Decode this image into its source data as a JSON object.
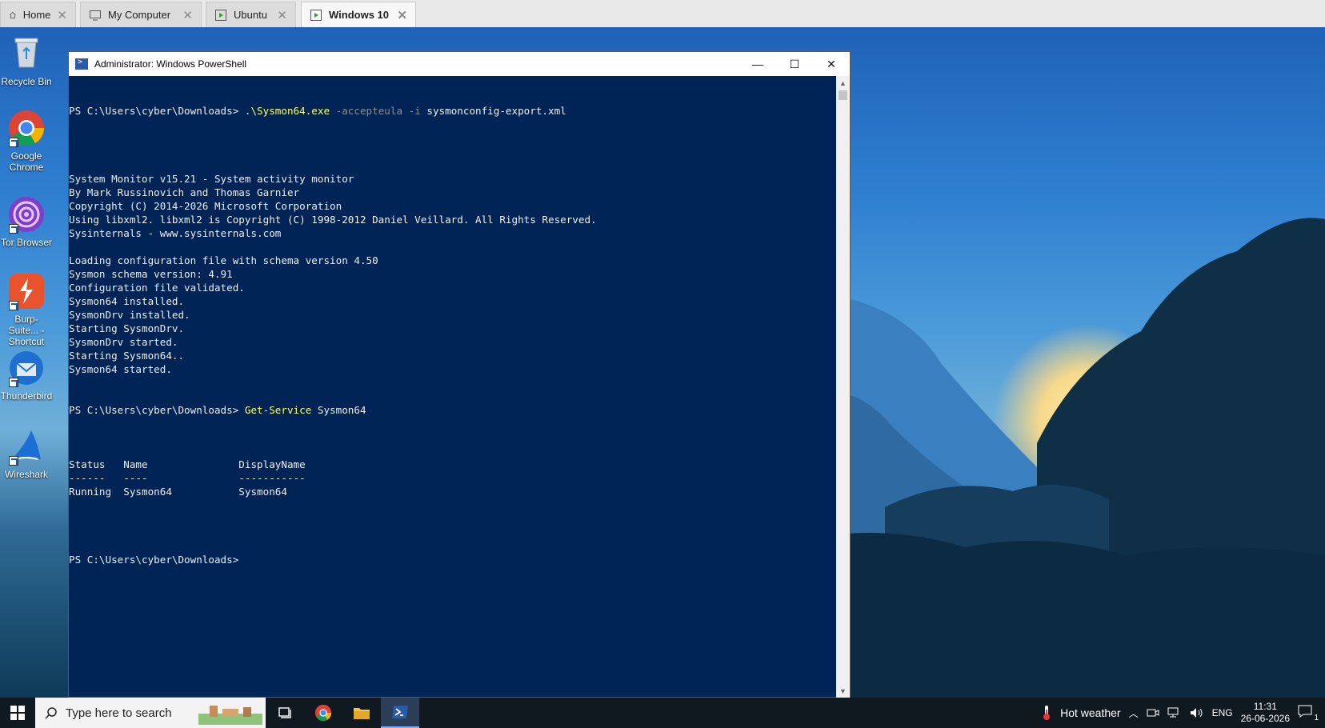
{
  "vm_tabs": [
    {
      "label": "Home",
      "icon": "home-icon"
    },
    {
      "label": "My Computer",
      "icon": "monitor-icon"
    },
    {
      "label": "Ubuntu",
      "icon": "vm-icon"
    },
    {
      "label": "Windows 10",
      "icon": "vm-icon",
      "active": true
    }
  ],
  "desktop_icons": [
    {
      "label": "Recycle Bin",
      "icon": "recycle-bin-icon"
    },
    {
      "label": "Google Chrome",
      "icon": "chrome-icon"
    },
    {
      "label": "Tor Browser",
      "icon": "tor-browser-icon"
    },
    {
      "label": "Burp-Suite... - Shortcut",
      "icon": "burp-suite-icon"
    },
    {
      "label": "Thunderbird",
      "icon": "thunderbird-icon"
    },
    {
      "label": "Wireshark",
      "icon": "wireshark-icon"
    }
  ],
  "window": {
    "title": "Administrator: Windows PowerShell",
    "minimize": "—",
    "maximize": "☐",
    "close": "✕"
  },
  "console": {
    "prompt": "PS C:\\Users\\cyber\\Downloads> ",
    "cmd1": {
      "exe": ".\\Sysmon64.exe",
      "args": " -accepteula -i",
      "file": " sysmonconfig-export.xml"
    },
    "output1": [
      "",
      "",
      "System Monitor v15.21 - System activity monitor",
      "By Mark Russinovich and Thomas Garnier",
      "Copyright (C) 2014-2026 Microsoft Corporation",
      "Using libxml2. libxml2 is Copyright (C) 1998-2012 Daniel Veillard. All Rights Reserved.",
      "Sysinternals - www.sysinternals.com",
      "",
      "Loading configuration file with schema version 4.50",
      "Sysmon schema version: 4.91",
      "Configuration file validated.",
      "Sysmon64 installed.",
      "SysmonDrv installed.",
      "Starting SysmonDrv.",
      "SysmonDrv started.",
      "Starting Sysmon64..",
      "Sysmon64 started."
    ],
    "cmd2": {
      "cmdlet": "Get-Service",
      "arg": " Sysmon64"
    },
    "output2": [
      "",
      "Status   Name               DisplayName",
      "------   ----               -----------",
      "Running  Sysmon64           Sysmon64",
      "",
      ""
    ]
  },
  "taskbar": {
    "search_placeholder": "Type here to search",
    "weather": "Hot weather",
    "language": "ENG",
    "time": "11:31",
    "date": "26-06-2026",
    "notification_count": "1"
  }
}
